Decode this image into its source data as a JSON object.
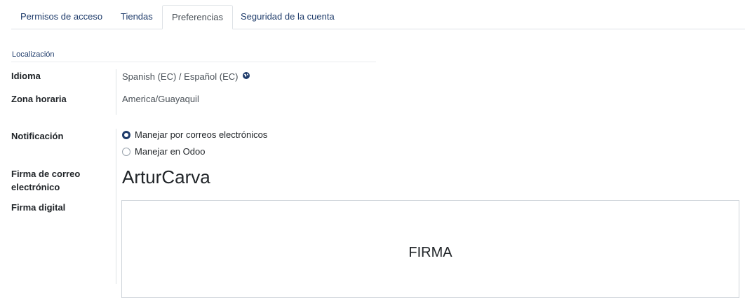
{
  "tabs": [
    {
      "label": "Permisos de acceso",
      "active": false
    },
    {
      "label": "Tiendas",
      "active": false
    },
    {
      "label": "Preferencias",
      "active": true
    },
    {
      "label": "Seguridad de la cuenta",
      "active": false
    }
  ],
  "section": {
    "title": "Localización"
  },
  "fields": {
    "language": {
      "label": "Idioma",
      "value": "Spanish (EC) / Español (EC)",
      "icon": "globe-icon"
    },
    "timezone": {
      "label": "Zona horaria",
      "value": "America/Guayaquil"
    },
    "notification": {
      "label": "Notificación",
      "options": [
        {
          "label": "Manejar por correos electrónicos",
          "selected": true
        },
        {
          "label": "Manejar en Odoo",
          "selected": false
        }
      ]
    },
    "email_signature": {
      "label": "Firma de correo electrónico",
      "value": "ArturCarva"
    },
    "digital_signature": {
      "label": "Firma digital",
      "placeholder": "FIRMA"
    }
  },
  "colors": {
    "accent": "#1f3c6b",
    "border": "#dee2e6"
  }
}
